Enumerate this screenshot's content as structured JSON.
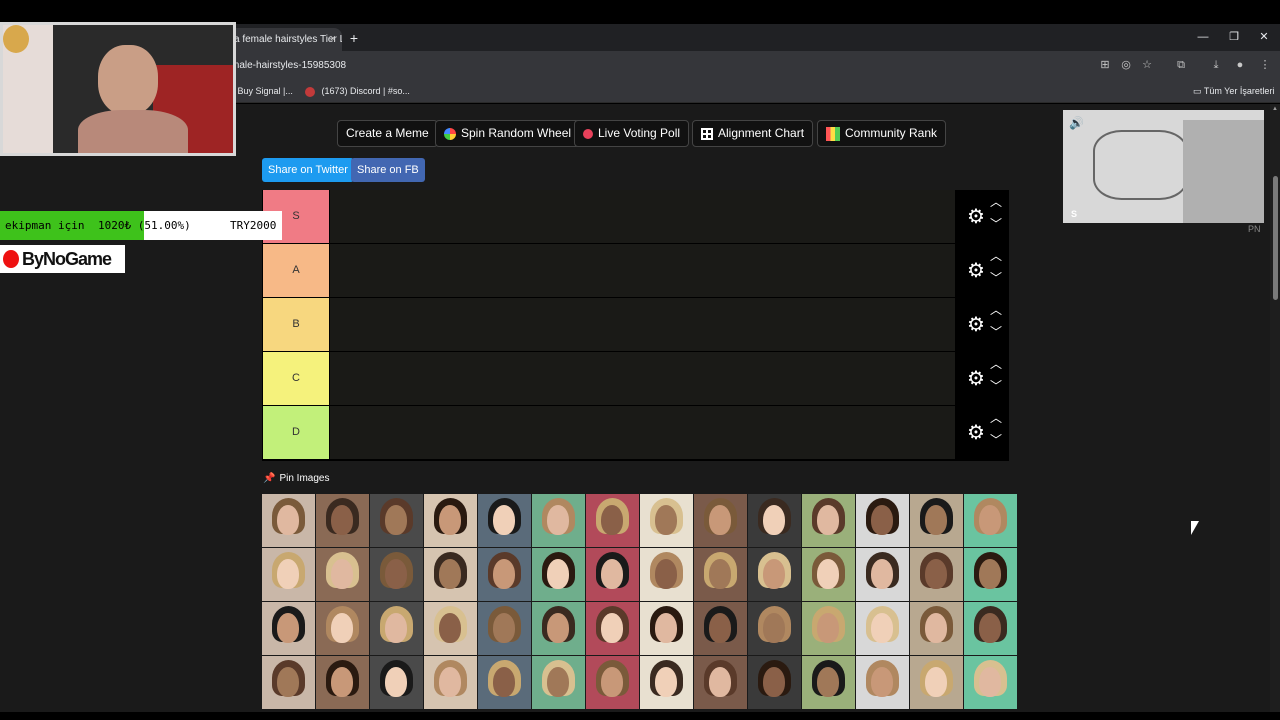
{
  "browser": {
    "tab_title": "a female hairstyles Tier L",
    "tab_close": "×",
    "new_tab": "+",
    "url": "male-hairstyles-15985308",
    "window_controls": [
      "—",
      "❐",
      "✕"
    ],
    "bookmarks": [
      {
        "label": "o Buy Signal |...",
        "icon": "bookmark-icon"
      },
      {
        "label": "(1673) Discord | #so...",
        "icon": "discord-icon"
      }
    ],
    "bookmarks_folder": "Tüm Yer İşaretleri"
  },
  "toolbar": {
    "create_meme": "Create a Meme",
    "spin_wheel": "Spin Random Wheel",
    "live_poll": "Live Voting Poll",
    "alignment": "Alignment Chart",
    "community": "Community Rank"
  },
  "share": {
    "twitter": "Share on Twitter",
    "fb": "Share on FB"
  },
  "tiers": [
    {
      "label": "S",
      "color": "#f07b85"
    },
    {
      "label": "A",
      "color": "#f7b987"
    },
    {
      "label": "B",
      "color": "#f7d77f"
    },
    {
      "label": "C",
      "color": "#f5f27c"
    },
    {
      "label": "D",
      "color": "#c2f07a"
    }
  ],
  "pin_images": "Pin Images",
  "overlay": {
    "donation_label": "ekipman için",
    "donation_amount": "1020₺ (51.00%)",
    "donation_goal": "TRY2000",
    "donation_progress": 0.51,
    "sponsor": "ByNoGame",
    "pip_tag": "S",
    "pip_pn": "PN"
  },
  "colors": {
    "page_bg": "#1a1a1a",
    "twitter": "#1d9bf0",
    "facebook": "#4267b2",
    "progress": "#3ec21b"
  }
}
